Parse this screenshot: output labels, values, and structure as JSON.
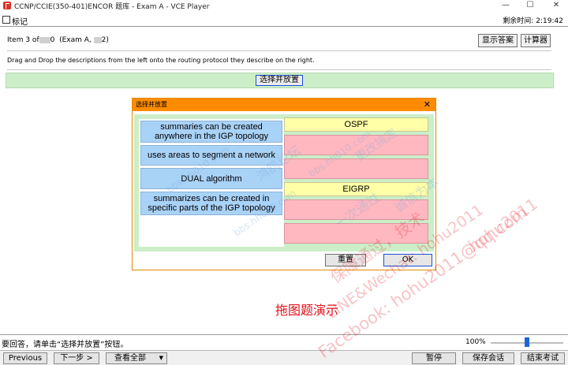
{
  "window": {
    "title": "CCNP/CCIE(350-401)ENCOR 题库 - Exam A - VCE Player",
    "minimize": "—",
    "maximize": "☐",
    "close": "✕"
  },
  "menubar": {
    "mark_label": "标记",
    "timer_label": "剩余时间:",
    "timer_value": "2:19:42"
  },
  "question": {
    "item_prefix": "Item 3 of",
    "item_suffix": "0",
    "exam_prefix": "(Exam A, ",
    "exam_suffix": "2)",
    "show_answer_label": "显示答案",
    "calculator_label": "计算器",
    "instruction": "Drag and Drop the descriptions from the left onto the routing protocol they describe on the right.",
    "select_place_label": "选择并放置"
  },
  "dialog": {
    "title": "选择并放置",
    "close": "✕",
    "drag_items": [
      "summaries can be created anywhere in the IGP topology",
      "uses areas to segment a network",
      "DUAL algorithm",
      "summarizes can be created in specific parts of the IGP topology"
    ],
    "targets": [
      {
        "protocol": "OSPF"
      },
      {
        "protocol": "EIGRP"
      }
    ],
    "reset_label": "重置",
    "ok_label": "OK"
  },
  "demo_text": "拖图题演示",
  "status": {
    "message": "要回答，请单击“选择并放置”按钮。",
    "zoom": "100%",
    "zoom_level_percent": 100
  },
  "bottom": {
    "previous": "Previous",
    "next": "下一步 >",
    "view_all": "查看全部",
    "view_all_arrow": "▼",
    "pause": "暂停",
    "save_session": "保存会话",
    "end_exam": "结束考试"
  },
  "watermarks": [
    "bbs.hh010.com",
    "鸿鹄论坛",
    "保障通过，技术",
    "LINE&Wechat: hohu2011",
    "Facebook: hohu2011@qq.com",
    "hohu2011",
    "一次通过",
    "诚信为本",
    "更改搞定"
  ],
  "colors": {
    "title_orange": "#ff8c00",
    "pane_green": "#cceec8",
    "drag_blue": "#a9d2f7",
    "target_yellow": "#ffffa8",
    "slot_pink": "#ffb8c0",
    "demo_red": "#e0101a",
    "focus_blue": "#1a4fd6"
  }
}
